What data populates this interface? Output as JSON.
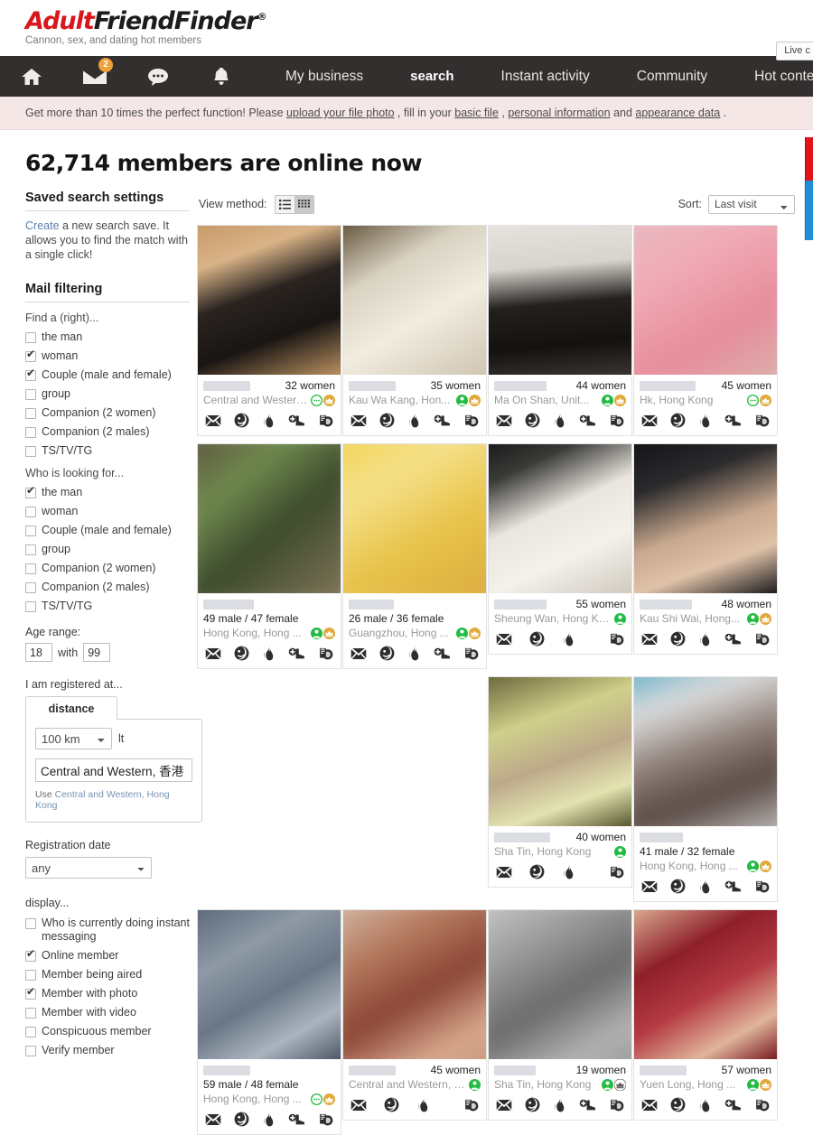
{
  "brand": {
    "name_part1": "Adult",
    "name_part2": "FriendFinder",
    "registered_mark": "®",
    "tagline": "Cannon, sex, and dating hot members",
    "live_label": "Live c",
    "logo_red": "#d8161c",
    "logo_black": "#1c1c1c"
  },
  "nav": {
    "icons": [
      {
        "name": "home-icon",
        "badge": ""
      },
      {
        "name": "mail-icon",
        "badge": "2"
      },
      {
        "name": "chat-icon",
        "badge": ""
      },
      {
        "name": "bell-icon",
        "badge": ""
      }
    ],
    "links": [
      {
        "label": "My business",
        "active": false
      },
      {
        "label": "search",
        "active": true
      },
      {
        "label": "Instant activity",
        "active": false
      },
      {
        "label": "Community",
        "active": false
      },
      {
        "label": "Hot content",
        "active": false
      }
    ],
    "badge_color": "#efa13c",
    "background": "#332f2e"
  },
  "promo": {
    "text_1": "Get more than 10 times the perfect function! Please ",
    "link_1": "upload your file photo",
    "text_2": " , fill in your ",
    "link_2": "basic file",
    "text_3": " , ",
    "link_3": "personal information",
    "text_4": " and ",
    "link_4": "appearance data",
    "text_5": " ."
  },
  "page": {
    "title": "62,714 members are online now"
  },
  "sidebar": {
    "saved_search": {
      "heading": "Saved search settings",
      "link": "Create",
      "text": " a new search save. It allows you to find the match with a single click!"
    },
    "mail_filtering": {
      "heading": "Mail filtering",
      "find_label": "Find a (right)...",
      "find_options": [
        {
          "label": "the man",
          "checked": false
        },
        {
          "label": "woman",
          "checked": true
        },
        {
          "label": "Couple (male and female)",
          "checked": true
        },
        {
          "label": "group",
          "checked": false
        },
        {
          "label": "Companion (2 women)",
          "checked": false
        },
        {
          "label": "Companion (2 males)",
          "checked": false
        },
        {
          "label": "TS/TV/TG",
          "checked": false
        }
      ],
      "looking_label": "Who is looking for...",
      "looking_options": [
        {
          "label": "the man",
          "checked": true
        },
        {
          "label": "woman",
          "checked": false
        },
        {
          "label": "Couple (male and female)",
          "checked": false
        },
        {
          "label": "group",
          "checked": false
        },
        {
          "label": "Companion (2 women)",
          "checked": false
        },
        {
          "label": "Companion (2 males)",
          "checked": false
        },
        {
          "label": "TS/TV/TG",
          "checked": false
        }
      ]
    },
    "age": {
      "label": "Age range:",
      "min": "18",
      "with": "with",
      "max": "99"
    },
    "location": {
      "label": "I am registered at...",
      "tab": "distance",
      "distance_value": "100 km",
      "distance_suffix": "lt",
      "place_value": "Central and Western, 香港",
      "use_prefix": "Use",
      "use_link": "Central and Western, Hong Kong"
    },
    "registration": {
      "label": "Registration date",
      "value": "any"
    },
    "display": {
      "label": "display...",
      "options": [
        {
          "label": "Who is currently doing instant messaging",
          "checked": false
        },
        {
          "label": "Online member",
          "checked": true
        },
        {
          "label": "Member being aired",
          "checked": false
        },
        {
          "label": "Member with photo",
          "checked": true
        },
        {
          "label": "Member with video",
          "checked": false
        },
        {
          "label": "Conspicuous member",
          "checked": false
        },
        {
          "label": "Verify member",
          "checked": false
        }
      ]
    }
  },
  "toolbar": {
    "view_label": "View method:",
    "view_list_icon": "list-view-icon",
    "view_grid_icon": "grid-view-icon",
    "view_selected": "grid",
    "sort_label": "Sort:",
    "sort_value": "Last visit"
  },
  "results": {
    "cards": [
      {
        "slot": 1,
        "age": "32 women",
        "couple": "",
        "location": "Central and Western, Hon...",
        "badges": [
          "chat-green",
          "crown-gold"
        ],
        "actions": [
          "mail",
          "wink",
          "flame",
          "boot",
          "coins"
        ],
        "photo": "photo-legs-stockings",
        "blurred": false,
        "uname_w": 52
      },
      {
        "slot": 2,
        "age": "35 women",
        "couple": "",
        "location": "Kau Wa Kang, Hon...",
        "badges": [
          "person-green",
          "crown-gold"
        ],
        "actions": [
          "mail",
          "wink",
          "flame",
          "boot",
          "coins"
        ],
        "photo": "photo-white-dress",
        "blurred": false,
        "uname_w": 52
      },
      {
        "slot": 3,
        "age": "44 women",
        "couple": "",
        "location": "Ma On Shan, Unit...",
        "badges": [
          "person-green",
          "crown-gold"
        ],
        "actions": [
          "mail",
          "wink",
          "flame",
          "boot",
          "coins"
        ],
        "photo": "photo-lace-stockings",
        "blurred": false,
        "uname_w": 58
      },
      {
        "slot": 4,
        "age": "45 women",
        "couple": "",
        "location": "Hk, Hong Kong",
        "badges": [
          "chat-green",
          "crown-gold"
        ],
        "actions": [
          "mail",
          "wink",
          "flame",
          "boot",
          "coins"
        ],
        "photo": "photo-pink",
        "blurred": true,
        "uname_w": 62
      },
      {
        "slot": 5,
        "age": "",
        "couple": "49 male / 47 female",
        "location": "Hong Kong, Hong ...",
        "badges": [
          "person-green",
          "crown-gold"
        ],
        "actions": [
          "mail",
          "wink",
          "flame",
          "boot",
          "coins"
        ],
        "photo": "photo-couple-green",
        "blurred": true,
        "uname_w": 56
      },
      {
        "slot": 6,
        "age": "",
        "couple": "26 male / 36 female",
        "location": "Guangzhou, Hong ...",
        "badges": [
          "person-green",
          "crown-gold"
        ],
        "actions": [
          "mail",
          "wink",
          "flame",
          "boot",
          "coins"
        ],
        "photo": "photo-yellow",
        "blurred": true,
        "uname_w": 50
      },
      {
        "slot": 7,
        "age": "55 women",
        "couple": "",
        "location": "Sheung Wan, Hong Kong",
        "badges": [
          "person-green"
        ],
        "actions": [
          "mail",
          "wink",
          "flame",
          "coins"
        ],
        "photo": "photo-white-top",
        "blurred": false,
        "uname_w": 58
      },
      {
        "slot": 8,
        "age": "48 women",
        "couple": "",
        "location": "Kau Shi Wai, Hong...",
        "badges": [
          "person-green",
          "crown-gold"
        ],
        "actions": [
          "mail",
          "wink",
          "flame",
          "boot",
          "coins"
        ],
        "photo": "photo-dark-top",
        "blurred": false,
        "uname_w": 58
      },
      {
        "slot": 11,
        "age": "40 women",
        "couple": "",
        "location": "Sha Tin, Hong Kong",
        "badges": [
          "person-green"
        ],
        "actions": [
          "mail",
          "wink",
          "flame",
          "coins"
        ],
        "photo": "photo-green-top",
        "blurred": false,
        "uname_w": 62
      },
      {
        "slot": 12,
        "age": "",
        "couple": "41 male / 32 female",
        "location": "Hong Kong, Hong ...",
        "badges": [
          "person-green",
          "crown-gold"
        ],
        "actions": [
          "mail",
          "wink",
          "flame",
          "boot",
          "coins"
        ],
        "photo": "photo-blurry-blue",
        "blurred": true,
        "uname_w": 48
      },
      {
        "slot": 13,
        "age": "",
        "couple": "59 male / 48 female",
        "location": "Hong Kong, Hong ...",
        "badges": [
          "chat-green",
          "crown-gold"
        ],
        "actions": [
          "mail",
          "wink",
          "flame",
          "boot",
          "coins"
        ],
        "photo": "photo-denim",
        "blurred": false,
        "uname_w": 52
      },
      {
        "slot": 14,
        "age": "45 women",
        "couple": "",
        "location": "Central and Western, Hon...",
        "badges": [
          "person-green"
        ],
        "actions": [
          "mail",
          "wink",
          "flame",
          "coins"
        ],
        "photo": "photo-skin",
        "blurred": true,
        "uname_w": 52
      },
      {
        "slot": 15,
        "age": "19 women",
        "couple": "",
        "location": "Sha Tin, Hong Kong",
        "badges": [
          "person-green",
          "crown-grey"
        ],
        "actions": [
          "mail",
          "wink",
          "flame",
          "boot",
          "coins"
        ],
        "photo": "photo-grey",
        "blurred": true,
        "uname_w": 46
      },
      {
        "slot": 16,
        "age": "57 women",
        "couple": "",
        "location": "Yuen Long, Hong ...",
        "badges": [
          "person-green",
          "crown-gold"
        ],
        "actions": [
          "mail",
          "wink",
          "flame",
          "boot",
          "coins"
        ],
        "photo": "photo-red-lace",
        "blurred": false,
        "uname_w": 52
      }
    ],
    "badge_green": "#22bb44",
    "badge_gold": "#e0a93a",
    "badge_grey": "#555555"
  }
}
